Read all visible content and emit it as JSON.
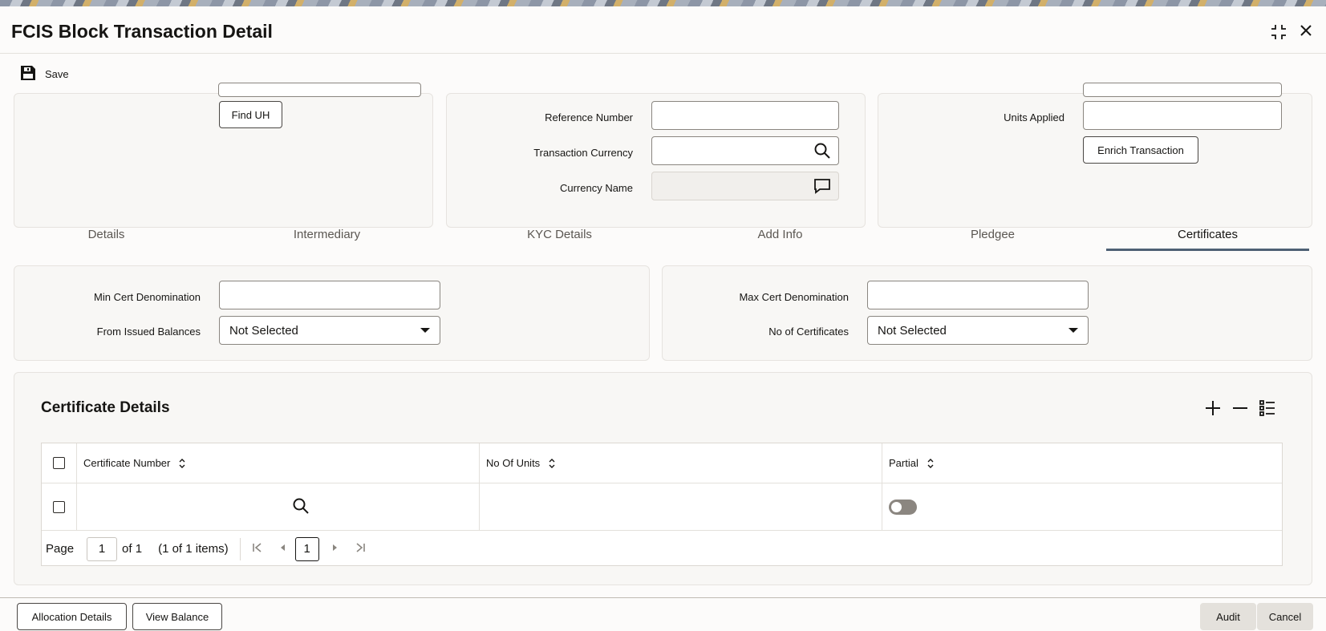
{
  "window": {
    "title": "FCIS Block Transaction Detail"
  },
  "toolbar": {
    "save_label": "Save"
  },
  "top_panel": {
    "find_uh_label": "Find UH",
    "reference_number_label": "Reference Number",
    "reference_number_value": "",
    "transaction_currency_label": "Transaction Currency",
    "transaction_currency_value": "",
    "currency_name_label": "Currency Name",
    "currency_name_value": "",
    "units_applied_label": "Units Applied",
    "units_applied_value": "",
    "enrich_transaction_label": "Enrich Transaction"
  },
  "tabs": [
    {
      "label": "Details"
    },
    {
      "label": "Intermediary"
    },
    {
      "label": "KYC Details"
    },
    {
      "label": "Add Info"
    },
    {
      "label": "Pledgee"
    },
    {
      "label": "Certificates"
    }
  ],
  "active_tab": "Certificates",
  "certificates": {
    "min_cert_denomination_label": "Min Cert Denomination",
    "min_cert_denomination_value": "",
    "from_issued_balances_label": "From Issued Balances",
    "from_issued_balances_value": "Not Selected",
    "max_cert_denomination_label": "Max Cert Denomination",
    "max_cert_denomination_value": "",
    "no_of_certificates_label": "No of Certificates",
    "no_of_certificates_value": "Not Selected"
  },
  "certificate_details": {
    "title": "Certificate Details",
    "columns": [
      "Certificate Number",
      "No Of Units",
      "Partial"
    ],
    "rows": [
      {
        "certificate_number": "",
        "no_of_units": "",
        "partial": false
      }
    ],
    "pager": {
      "page_label": "Page",
      "page_value": "1",
      "of_label": "of 1",
      "items_label": "(1 of 1 items)",
      "current_page": "1"
    }
  },
  "footer": {
    "allocation_details_label": "Allocation Details",
    "view_balance_label": "View Balance",
    "audit_label": "Audit",
    "cancel_label": "Cancel"
  },
  "colors": {
    "accent_tab_underline": "#4e6075",
    "panel_bg": "#f8f7f5",
    "page_bg": "#fcfbfa"
  }
}
